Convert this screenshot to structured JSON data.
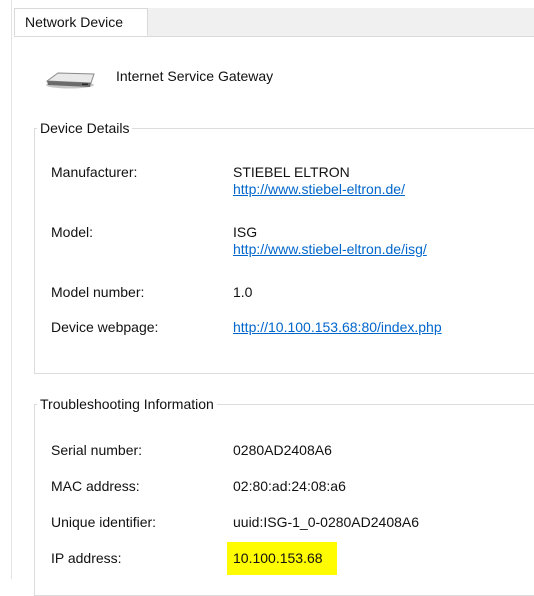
{
  "window": {
    "tab_label": "Network Device"
  },
  "device": {
    "name": "Internet Service Gateway",
    "icon": "router-icon"
  },
  "device_details": {
    "legend": "Device Details",
    "manufacturer_label": "Manufacturer:",
    "manufacturer_name": "STIEBEL ELTRON",
    "manufacturer_url": "http://www.stiebel-eltron.de/",
    "model_label": "Model:",
    "model_name": "ISG",
    "model_url": "http://www.stiebel-eltron.de/isg/",
    "model_number_label": "Model number:",
    "model_number": "1.0",
    "webpage_label": "Device webpage:",
    "webpage_url": "http://10.100.153.68:80/index.php"
  },
  "troubleshooting": {
    "legend": "Troubleshooting Information",
    "serial_label": "Serial number:",
    "serial": "0280AD2408A6",
    "mac_label": "MAC address:",
    "mac": "02:80:ad:24:08:a6",
    "uid_label": "Unique identifier:",
    "uid": "uuid:ISG-1_0-0280AD2408A6",
    "ip_label": "IP address:",
    "ip": "10.100.153.68",
    "ip_highlight_color": "#fffb00"
  },
  "colors": {
    "link": "#0066cc",
    "tabstrip_bg": "#f0f0f0",
    "border": "#dcdcdc"
  }
}
